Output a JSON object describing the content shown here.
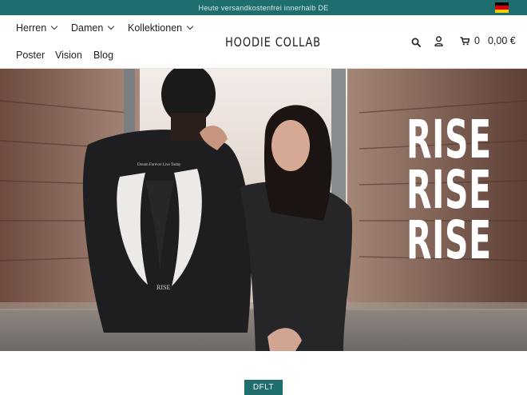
{
  "announcement": {
    "text": "Heute versandkostenfrei innerhalb DE"
  },
  "flag": {
    "icon": "germany-flag-icon",
    "colors": [
      "#000000",
      "#dd0000",
      "#ffce00"
    ]
  },
  "nav": {
    "herren": "Herren",
    "damen": "Damen",
    "kollektionen": "Kollektionen",
    "poster": "Poster",
    "vision": "Vision",
    "blog": "Blog"
  },
  "logo": {
    "text": "HOODIE COLLAB"
  },
  "header_icons": {
    "search": "search-icon",
    "account": "user-icon",
    "cart": "cart-icon"
  },
  "cart": {
    "count": "0",
    "total": "0,00 €"
  },
  "hero": {
    "lines": [
      "RISE",
      "RISE",
      "RISE"
    ],
    "wing_print_line_1": "Dream Forever Live Today",
    "wing_print_word": "RISE"
  },
  "badge": {
    "label": "DFLT"
  },
  "colors": {
    "accent": "#1f6e6e",
    "text": "#222222"
  }
}
